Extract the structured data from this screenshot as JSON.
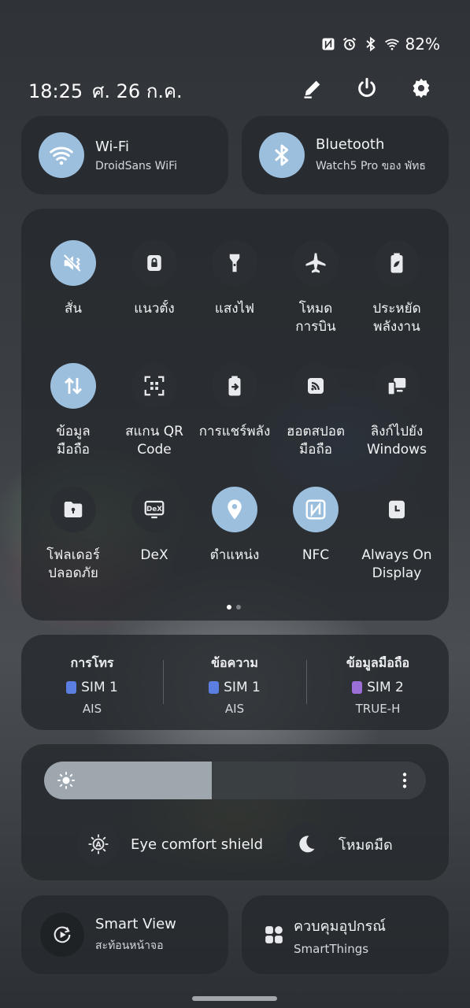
{
  "status": {
    "battery": "82%",
    "icons": [
      "nfc-icon",
      "alarm-icon",
      "bluetooth-icon",
      "wifi-icon"
    ]
  },
  "header": {
    "time": "18:25",
    "date": "ศ. 26 ก.ค."
  },
  "wifi": {
    "label": "Wi-Fi",
    "network": "DroidSans WiFi",
    "active": true
  },
  "bluetooth": {
    "label": "Bluetooth",
    "device": "Watch5 Pro ของ พัทธ",
    "active": true
  },
  "tiles": [
    {
      "label": "สั่น",
      "icon": "vibrate-icon",
      "active": true
    },
    {
      "label": "แนวตั้ง",
      "icon": "portrait-lock-icon",
      "active": false
    },
    {
      "label": "แสงไฟ",
      "icon": "flashlight-icon",
      "active": false
    },
    {
      "label": "โหมด\nการบิน",
      "icon": "airplane-icon",
      "active": false
    },
    {
      "label": "ประหยัด\nพลังงาน",
      "icon": "battery-saver-icon",
      "active": false
    },
    {
      "label": "ข้อมูล\nมือถือ",
      "icon": "mobile-data-icon",
      "active": true
    },
    {
      "label": "สแกน QR\nCode",
      "icon": "qr-scan-icon",
      "active": false
    },
    {
      "label": "การแชร์พลัง",
      "icon": "power-share-icon",
      "active": false
    },
    {
      "label": "ฮอตสปอต\nมือถือ",
      "icon": "hotspot-icon",
      "active": false
    },
    {
      "label": "ลิงก์ไปยัง\nWindows",
      "icon": "link-windows-icon",
      "active": false
    },
    {
      "label": "โฟลเดอร์\nปลอดภัย",
      "icon": "secure-folder-icon",
      "active": false
    },
    {
      "label": "DeX",
      "icon": "dex-icon",
      "active": false
    },
    {
      "label": "ตำแหน่ง",
      "icon": "location-icon",
      "active": true
    },
    {
      "label": "NFC",
      "icon": "nfc-tile-icon",
      "active": true
    },
    {
      "label": "Always On\nDisplay",
      "icon": "aod-icon",
      "active": false
    }
  ],
  "pages": {
    "current": 1,
    "total": 2
  },
  "sim": [
    {
      "heading": "การโทร",
      "sim": "SIM 1",
      "carrier": "AIS",
      "color": "#5b7fe0"
    },
    {
      "heading": "ข้อความ",
      "sim": "SIM 1",
      "carrier": "AIS",
      "color": "#5b7fe0"
    },
    {
      "heading": "ข้อมูลมือถือ",
      "sim": "SIM 2",
      "carrier": "TRUE-H",
      "color": "#9a6fd6"
    }
  ],
  "brightness": {
    "level": 0.44
  },
  "eye_comfort": {
    "label": "Eye comfort shield"
  },
  "dark_mode": {
    "label": "โหมดมืด"
  },
  "smart_view": {
    "title": "Smart View",
    "subtitle": "สะท้อนหน้าจอ"
  },
  "smartthings": {
    "title": "ควบคุมอุปกรณ์",
    "subtitle": "SmartThings"
  }
}
